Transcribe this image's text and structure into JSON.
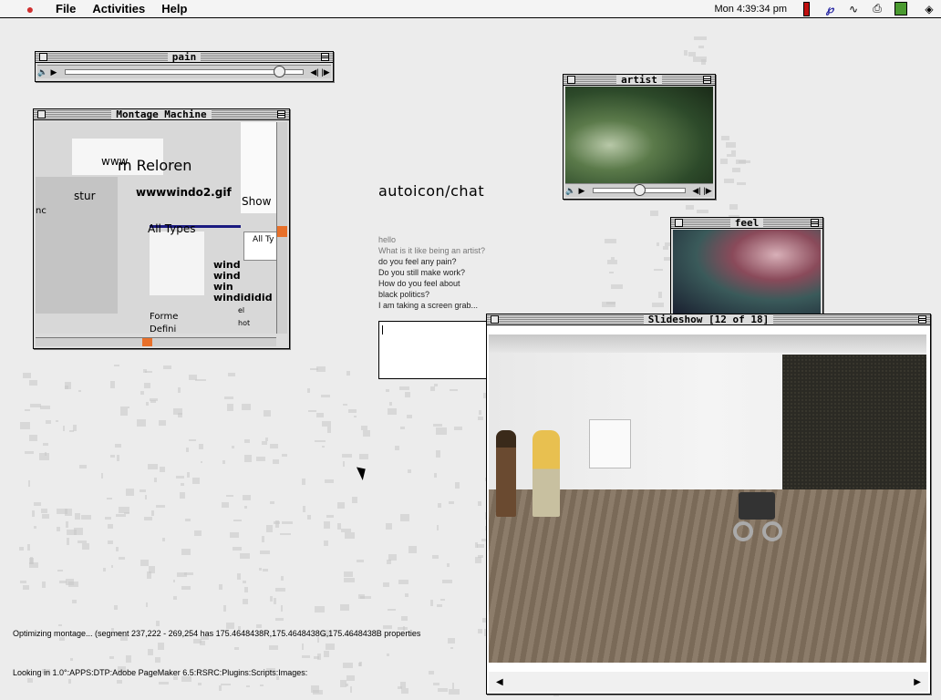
{
  "menubar": {
    "items": [
      "File",
      "Activities",
      "Help"
    ],
    "clock": "Mon 4:39:34 pm"
  },
  "windows": {
    "pain": {
      "title": "pain",
      "playback_position": 0.9
    },
    "montage": {
      "title": "Montage Machine",
      "fragments": [
        "www",
        "m Reloren",
        "wwwwindo2.gif",
        "Show",
        "All Types",
        "All Ty",
        "wind",
        "wind",
        "win",
        "windididid",
        "Forme",
        "Defini",
        "hot",
        "el",
        "stur",
        "nc"
      ]
    },
    "artist": {
      "title": "artist",
      "playback_position": 0.5
    },
    "feel": {
      "title": "feel"
    },
    "slideshow": {
      "title": "Slideshow [12 of 18]"
    }
  },
  "chat": {
    "title": "autoicon/chat",
    "lines": [
      "hello",
      "What is it like being an artist?",
      "do you feel any pain?",
      "Do you still make work?",
      "How do you feel about",
      "black politics?",
      "I am taking a screen grab..."
    ],
    "input_value": ""
  },
  "status": {
    "line1": "Optimizing montage... (segment 237,222 - 269,254 has 175.4648438R,175.4648438G,175.4648438B properties",
    "line2": "Looking in 1.0°:APPS:DTP:Adobe PageMaker 6.5:RSRC:Plugins:Scripts:Images:"
  },
  "colors": {
    "desktop": "#ececec",
    "apple": "#d03030",
    "scroll_thumb": "#e8702a"
  }
}
